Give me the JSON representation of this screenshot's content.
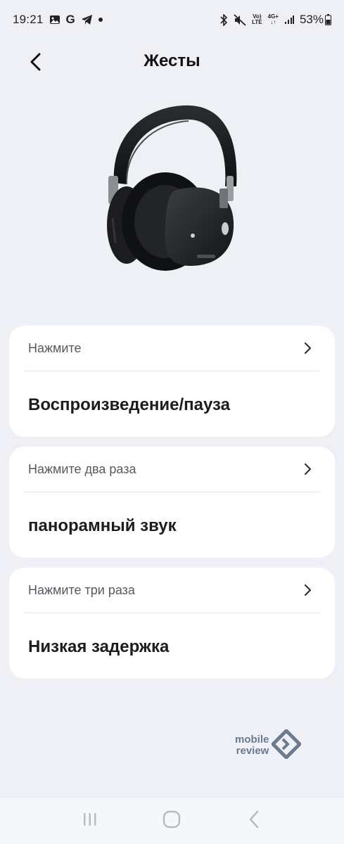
{
  "status_bar": {
    "time": "19:21",
    "battery": "53%",
    "volte_top": "Vo)",
    "volte_bottom": "LTE",
    "net_top": "4G+",
    "net_bottom": "↓↑",
    "icons": [
      "gallery-icon",
      "google-icon",
      "telegram-icon",
      "dot-icon",
      "bluetooth-icon",
      "mute-icon",
      "signal-icon",
      "battery-icon"
    ]
  },
  "header": {
    "title": "Жесты",
    "back_icon": "chevron-left-icon"
  },
  "gestures": [
    {
      "label": "Нажмите",
      "value": "Воспроизведение/пауза"
    },
    {
      "label": "Нажмите два раза",
      "value": "панорамный звук"
    },
    {
      "label": "Нажмите три раза",
      "value": "Низкая задержка"
    }
  ],
  "watermark": {
    "line1": "mobile",
    "line2": "review"
  },
  "nav": {
    "icons": [
      "recent-apps-icon",
      "home-icon",
      "back-icon"
    ]
  },
  "colors": {
    "background": "#eef0f5",
    "card": "#ffffff",
    "text": "#1c1c1e",
    "muted": "#555a60"
  }
}
